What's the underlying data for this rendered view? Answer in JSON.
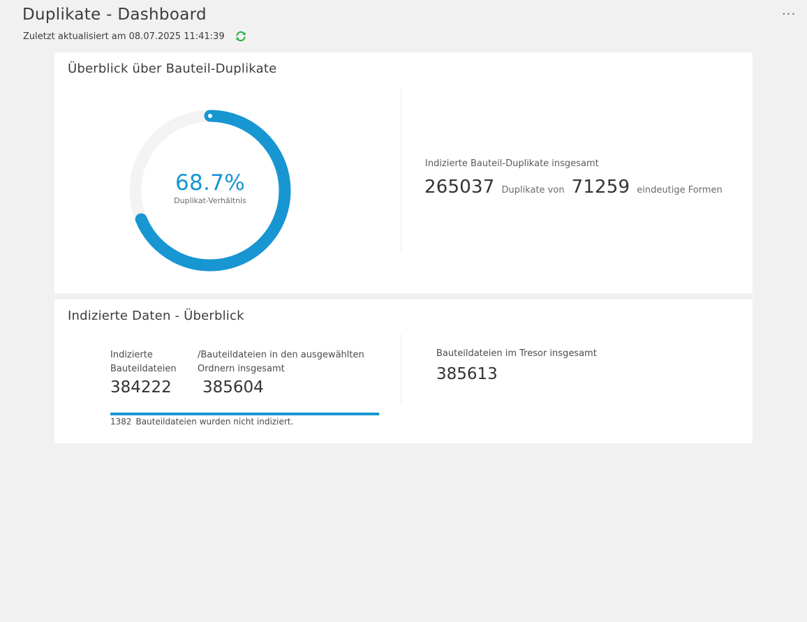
{
  "header": {
    "title": "Duplikate - Dashboard",
    "updated_text": "Zuletzt aktualisiert am 08.07.2025 11:41:39",
    "refresh_icon": "refresh-icon",
    "more_icon": "more-horizontal-icon",
    "more_label": "···"
  },
  "colors": {
    "accent": "#1796d2",
    "refresh": "#2bb34a",
    "background": "#f1f1f1",
    "card": "#ffffff",
    "track": "#f3f3f3"
  },
  "overview": {
    "title": "Überblick über Bauteil-Duplikate",
    "ratio_value": 0.687,
    "ratio_text": "68.7%",
    "ratio_label": "Duplikat-Verhältnis",
    "total_title": "Indizierte Bauteil-Duplikate insgesamt",
    "duplicates": "265037",
    "duplicates_of": "Duplikate von",
    "unique": "71259",
    "unique_label": "eindeutige Formen"
  },
  "indexed": {
    "title": "Indizierte Daten - Überblick",
    "indexed_label": "Indizierte Bauteildateien",
    "indexed_value": "384222",
    "selected_label": "/Bauteildateien in den ausgewählten Ordnern insgesamt",
    "selected_value": "385604",
    "progress_value": 0.9964,
    "not_indexed_count": "1382",
    "not_indexed_text": "Bauteildateien wurden nicht indiziert.",
    "vault_label": "Bauteildateien im Tresor insgesamt",
    "vault_value": "385613"
  }
}
